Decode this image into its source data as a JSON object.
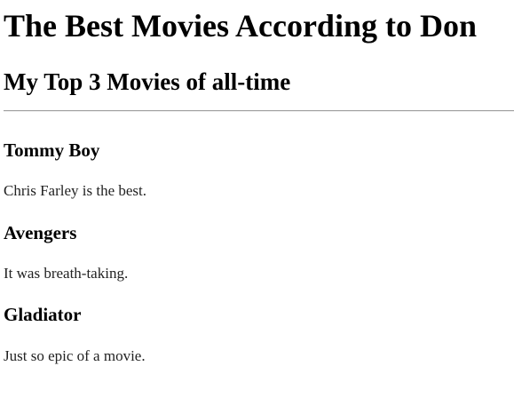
{
  "page": {
    "title": "The Best Movies According to Don",
    "subtitle": "My Top 3 Movies of all-time"
  },
  "movies": [
    {
      "name": "Tommy Boy",
      "review": "Chris Farley is the best."
    },
    {
      "name": "Avengers",
      "review": "It was breath-taking."
    },
    {
      "name": "Gladiator",
      "review": "Just so epic of a movie."
    }
  ]
}
